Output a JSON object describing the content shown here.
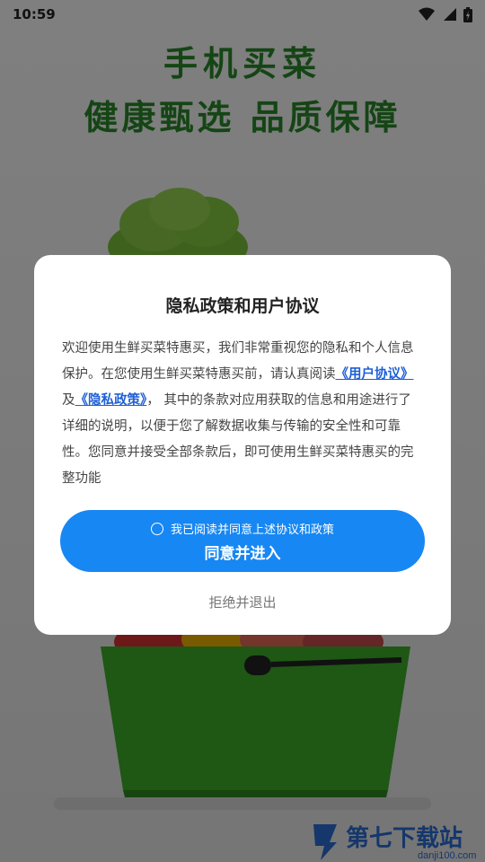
{
  "status_bar": {
    "time": "10:59",
    "icons": [
      "wifi-icon",
      "signal-icon",
      "battery-icon"
    ]
  },
  "splash": {
    "headline_1": "手机买菜",
    "headline_2": "健康甄选 品质保障",
    "brand_color": "#2a8a2a"
  },
  "dialog": {
    "title": "隐私政策和用户协议",
    "body_part_1": "欢迎使用生鲜买菜特惠买，我们非常重视您的隐私和个人信息保护。在您使用生鲜买菜特惠买前，请认真阅读",
    "link_user_agreement": "《用户协议》",
    "body_and": "及",
    "link_privacy_policy": "《隐私政策》",
    "body_part_2": "， 其中的条款对应用获取的信息和用途进行了详细的说明，以便于您了解数据收集与传输的安全性和可靠性。您同意并接受全部条款后，即可使用生鲜买菜特惠买的完整功能",
    "consent_checkbox_label": "我已阅读并同意上述协议和政策",
    "agree_button": "同意并进入",
    "reject_button": "拒绝并退出",
    "accent_color": "#1787f3",
    "link_color": "#1e5fd6"
  },
  "watermark": {
    "text": "第七下载站",
    "url": "danji100.com"
  }
}
